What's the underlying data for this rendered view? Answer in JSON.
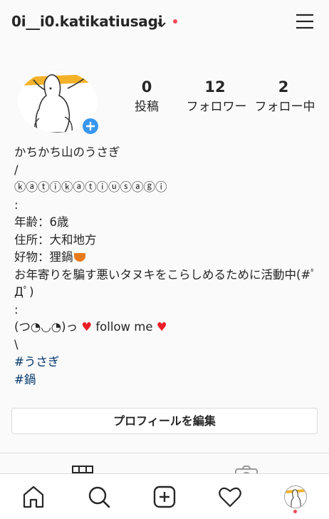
{
  "header": {
    "username": "0i__i0.katikatiusagi"
  },
  "stats": [
    {
      "count": "0",
      "label": "投稿"
    },
    {
      "count": "12",
      "label": "フォロワー"
    },
    {
      "count": "2",
      "label": "フォロー中"
    }
  ],
  "bio": {
    "name": "かちかち山のうさぎ",
    "slash": "/",
    "circled_name": "ⓚⓐⓣⓘⓚⓐⓣⓘⓤⓢⓐⓖⓘ",
    "colon1": ":",
    "age": "年齢：6歳",
    "address": "住所：大和地方",
    "favorite": "好物：狸鍋",
    "activity": "お年寄りを騙す悪いタヌキをこらしめるために活動中(#ﾟДﾟ)",
    "colon2": ":",
    "follow_pre": "(つ◔◡◔)っ",
    "heart": "♥",
    "follow_text": " follow me ",
    "backslash": "\\",
    "hashtag1": "#うさぎ",
    "hashtag2": "#鍋"
  },
  "edit_profile_label": "プロフィールを編集",
  "colors": {
    "accent_blue": "#3897f0",
    "notification_red": "#ed4956",
    "hashtag": "#003569",
    "heart": "#ed1c24"
  },
  "icons": {
    "header": [
      "chevron-down-icon",
      "menu-icon"
    ],
    "tabs": [
      "grid-icon",
      "tagged-icon"
    ],
    "bottom_nav": [
      "home-icon",
      "search-icon",
      "new-post-icon",
      "heart-icon",
      "profile-avatar"
    ]
  }
}
